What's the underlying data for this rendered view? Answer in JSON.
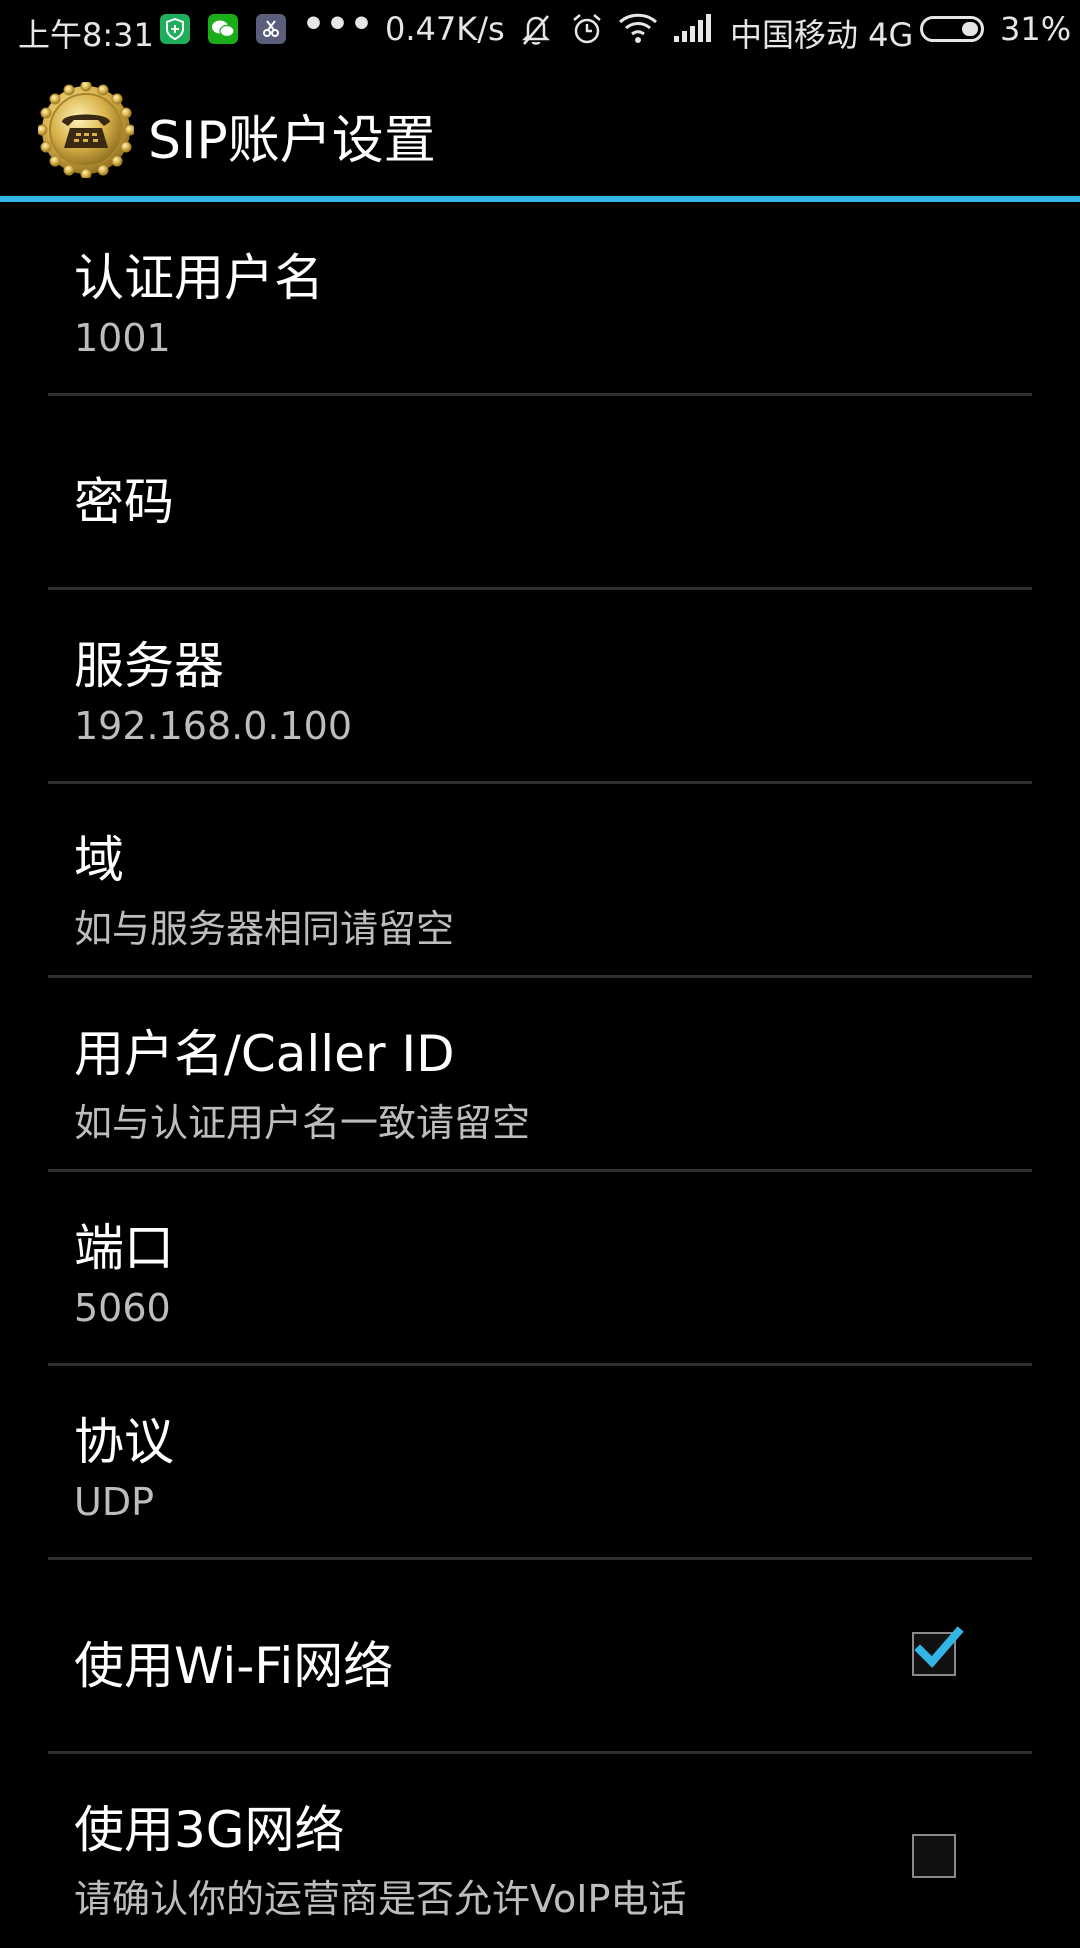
{
  "status_bar": {
    "time": "上午8:31",
    "apps": [
      {
        "icon": "shield-app-icon",
        "color": "#1fae5b"
      },
      {
        "icon": "wechat-icon",
        "color": "#1aad19"
      },
      {
        "icon": "scissors-app-icon",
        "color": "#5a5e7a"
      }
    ],
    "more": "•••",
    "net_speed": "0.47K/s",
    "icons": [
      "bell-muted-icon",
      "alarm-icon",
      "wifi-icon",
      "signal-icon"
    ],
    "carrier": "中国移动 4G",
    "battery_percent": "31%",
    "battery_level": 0.31
  },
  "title_bar": {
    "title": "SIP账户设置",
    "icon": "phone-seal-icon"
  },
  "colors": {
    "accent": "#33b5e5",
    "background": "#000000",
    "summary_text": "#bdbdbd",
    "divider": "#2e2e2e",
    "seal_gold": "#d9b24a"
  },
  "preferences": [
    {
      "title": "认证用户名",
      "summary": "1001"
    },
    {
      "title": "密码",
      "summary": ""
    },
    {
      "title": "服务器",
      "summary": "192.168.0.100"
    },
    {
      "title": "域",
      "summary": "如与服务器相同请留空"
    },
    {
      "title": "用户名/Caller ID",
      "summary": "如与认证用户名一致请留空"
    },
    {
      "title": "端口",
      "summary": "5060"
    },
    {
      "title": "协议",
      "summary": "UDP"
    },
    {
      "title": "使用Wi-Fi网络",
      "summary": "",
      "checked": true
    },
    {
      "title": "使用3G网络",
      "summary": "请确认你的运营商是否允许VoIP电话",
      "checked": false
    }
  ]
}
